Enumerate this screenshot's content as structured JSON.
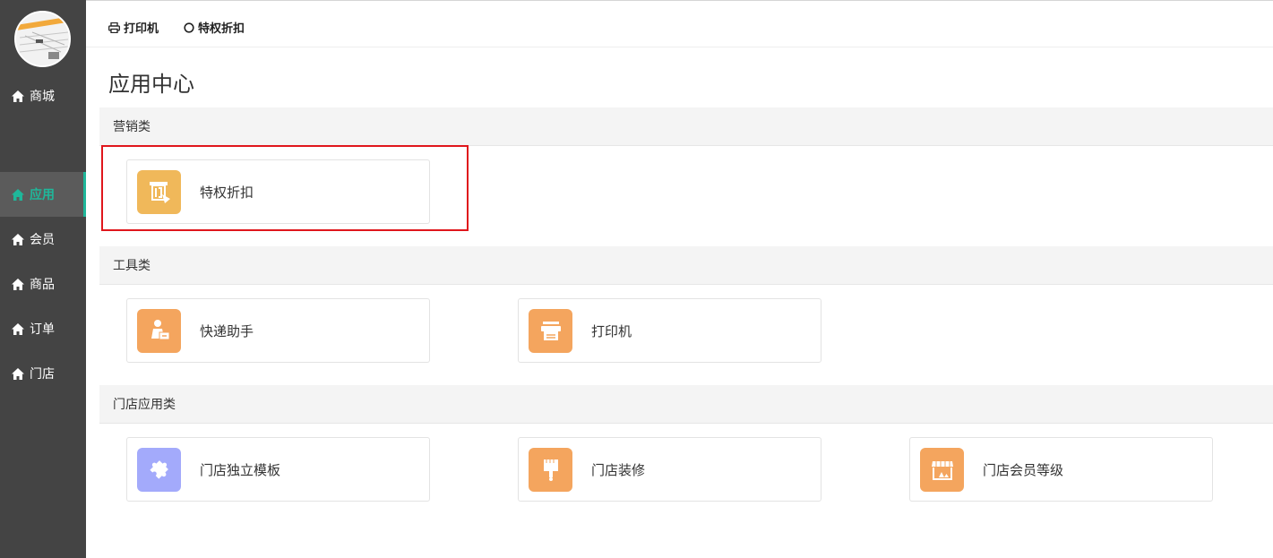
{
  "sidebar": {
    "items": [
      {
        "label": "商城"
      },
      {
        "label": "应用"
      },
      {
        "label": "会员"
      },
      {
        "label": "商品"
      },
      {
        "label": "订单"
      },
      {
        "label": "门店"
      }
    ],
    "active_color": "#1fb79a"
  },
  "topbar": {
    "links": [
      {
        "label": "打印机",
        "icon": "printer-icon"
      },
      {
        "label": "特权折扣",
        "icon": "circle-icon"
      }
    ]
  },
  "page": {
    "title": "应用中心"
  },
  "sections": [
    {
      "title": "营销类",
      "apps": [
        {
          "label": "特权折扣",
          "icon": "discount-ticket-icon",
          "color": "#f0b85a"
        }
      ]
    },
    {
      "title": "工具类",
      "apps": [
        {
          "label": "快递助手",
          "icon": "courier-icon",
          "color": "#f4a55e"
        },
        {
          "label": "打印机",
          "icon": "printer-icon",
          "color": "#f4a55e"
        }
      ]
    },
    {
      "title": "门店应用类",
      "apps": [
        {
          "label": "门店独立模板",
          "icon": "puzzle-icon",
          "color": "#a3aafb"
        },
        {
          "label": "门店装修",
          "icon": "paint-brush-icon",
          "color": "#f4a55e"
        },
        {
          "label": "门店会员等级",
          "icon": "storefront-icon",
          "color": "#f4a55e"
        }
      ]
    }
  ],
  "highlight_color": "#e0161c"
}
